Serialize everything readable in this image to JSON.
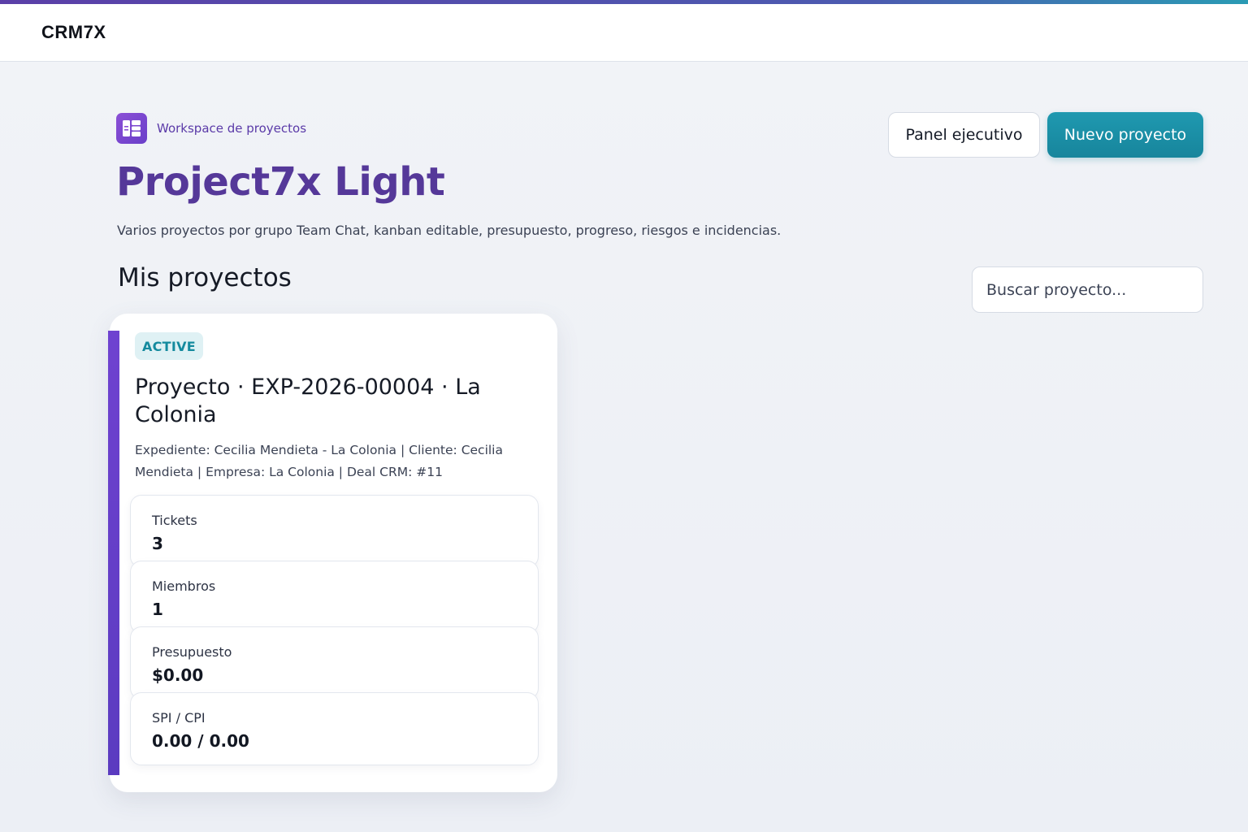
{
  "app": {
    "logo": "CRM7X"
  },
  "header": {
    "workspace_label": "Workspace de proyectos",
    "title": "Project7x Light",
    "subtitle": "Varios proyectos por grupo Team Chat, kanban editable, presupuesto, progreso, riesgos e incidencias."
  },
  "actions": {
    "panel_label": "Panel ejecutivo",
    "new_label": "Nuevo proyecto"
  },
  "projects": {
    "section_title": "Mis proyectos",
    "search_placeholder": "Buscar proyecto...",
    "items": [
      {
        "status": "ACTIVE",
        "title": "Proyecto · EXP-2026-00004 · La Colonia",
        "description": "Expediente: Cecilia Mendieta - La Colonia | Cliente: Cecilia Mendieta | Empresa: La Colonia | Deal CRM: #11",
        "stats": [
          {
            "label": "Tickets",
            "value": "3"
          },
          {
            "label": "Miembros",
            "value": "1"
          },
          {
            "label": "Presupuesto",
            "value": "$0.00"
          },
          {
            "label": "SPI / CPI",
            "value": "0.00 / 0.00"
          }
        ]
      }
    ]
  },
  "colors": {
    "brand_purple": "#553899",
    "accent_teal": "#1f99b0",
    "card_accent": "#6f42d0"
  }
}
